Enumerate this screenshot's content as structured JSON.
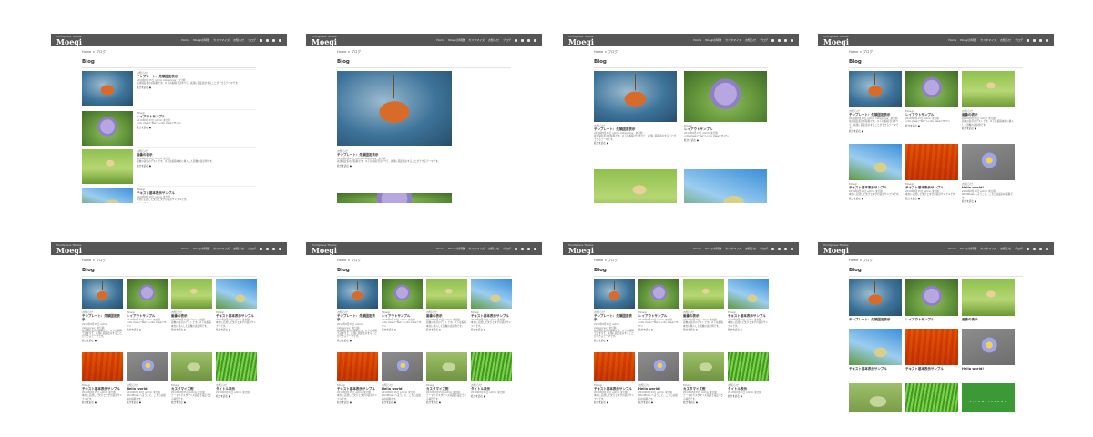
{
  "header": {
    "subtitle": "Wordpress Theme",
    "title": "Moegi",
    "nav": [
      "Home",
      "Moegiの特徴",
      "カスタマイズ",
      "お知らせ",
      "ブログ"
    ],
    "icons": [
      "home-icon",
      "rss-icon",
      "feed-icon",
      "search-icon"
    ]
  },
  "breadcrumb": "Home > ブログ",
  "page_title": "Blog",
  "posts": [
    {
      "category": "お知らせ",
      "title": "テンプレート：先頭固定表示",
      "meta": "2019年8月25日  admin  Categories：未分類",
      "excerpt": "先頭固定表示の投稿です。以下の投稿ではすべて、先頭に固定表示することができるテーマです。",
      "image": "lantern"
    },
    {
      "category": "Moegi",
      "title": "レイアウトサンプル",
      "meta": "2019年8月23日  admin  未分類",
      "excerpt": "<div class=\"flex\"><div class=\"fl-3\">",
      "image": "thistle"
    },
    {
      "category": "お知らせ",
      "title": "画像の表示",
      "meta": "2019年8月20日  admin  未分類",
      "excerpt": "画像の表示のテストです。以下は投稿本文に挿入した画像の表示例です。",
      "image": "bud"
    },
    {
      "category": "Moegi",
      "title": "テキスト基本表示サンプル",
      "meta": "2019年8月18日  admin  未分類",
      "excerpt": "本文に記述した文字とタグの表示サンプルです。",
      "image": "sky"
    },
    {
      "category": "Moegi",
      "title": "テキスト基本表示サンプル",
      "meta": "2019年8月15日  admin  未分類",
      "excerpt": "本文に記述した文字とタグの表示サンプルです。",
      "image": "orange"
    },
    {
      "category": "お知らせ",
      "title": "Hello world!",
      "meta": "2019年8月10日  admin  未分類",
      "excerpt": "WordPress へようこそ。こちらは最初の投稿です。",
      "image": "daisy"
    },
    {
      "category": "Moegi",
      "title": "カスタマイズ例",
      "meta": "2019年8月05日  admin  未分類",
      "excerpt": "テーマのカスタマイズ画面で設定できる項目です。",
      "image": "gball"
    },
    {
      "category": "お知らせ",
      "title": "タイトル表示",
      "meta": "2019年8月01日  admin  未分類",
      "excerpt": "",
      "image": "grass"
    }
  ],
  "read_more": "続きを読む ●",
  "panel9_green_label": "L I N K   W I T H   L O G O",
  "colors": {
    "header_bg": "#565656",
    "accent_green": "#3b9a35"
  }
}
